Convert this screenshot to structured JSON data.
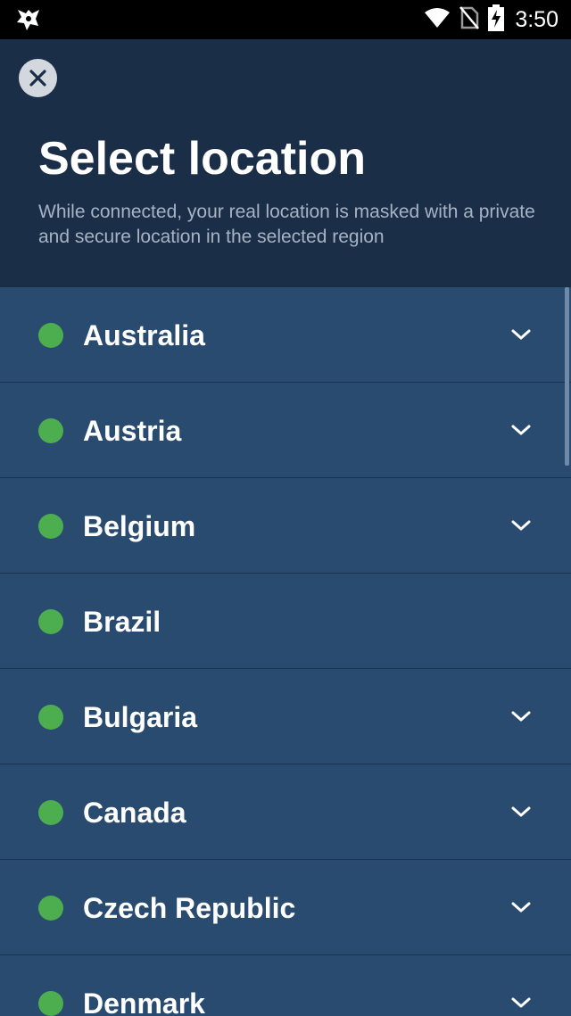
{
  "status_bar": {
    "time": "3:50",
    "icons": [
      "app-icon",
      "wifi-icon",
      "no-sim-icon",
      "battery-charging-icon"
    ]
  },
  "header": {
    "close_icon": "close-icon",
    "title": "Select location",
    "subtitle": "While connected, your real location is masked with a private and secure location in the selected region"
  },
  "locations": [
    {
      "name": "Australia",
      "status": "available",
      "expandable": true
    },
    {
      "name": "Austria",
      "status": "available",
      "expandable": true
    },
    {
      "name": "Belgium",
      "status": "available",
      "expandable": true
    },
    {
      "name": "Brazil",
      "status": "available",
      "expandable": false
    },
    {
      "name": "Bulgaria",
      "status": "available",
      "expandable": true
    },
    {
      "name": "Canada",
      "status": "available",
      "expandable": true
    },
    {
      "name": "Czech Republic",
      "status": "available",
      "expandable": true
    },
    {
      "name": "Denmark",
      "status": "available",
      "expandable": true
    }
  ],
  "colors": {
    "header_bg": "#1b2e48",
    "list_bg": "#2a4b70",
    "status_available": "#4cae4f",
    "text_primary": "#ffffff",
    "text_secondary": "#a7b3c2"
  }
}
